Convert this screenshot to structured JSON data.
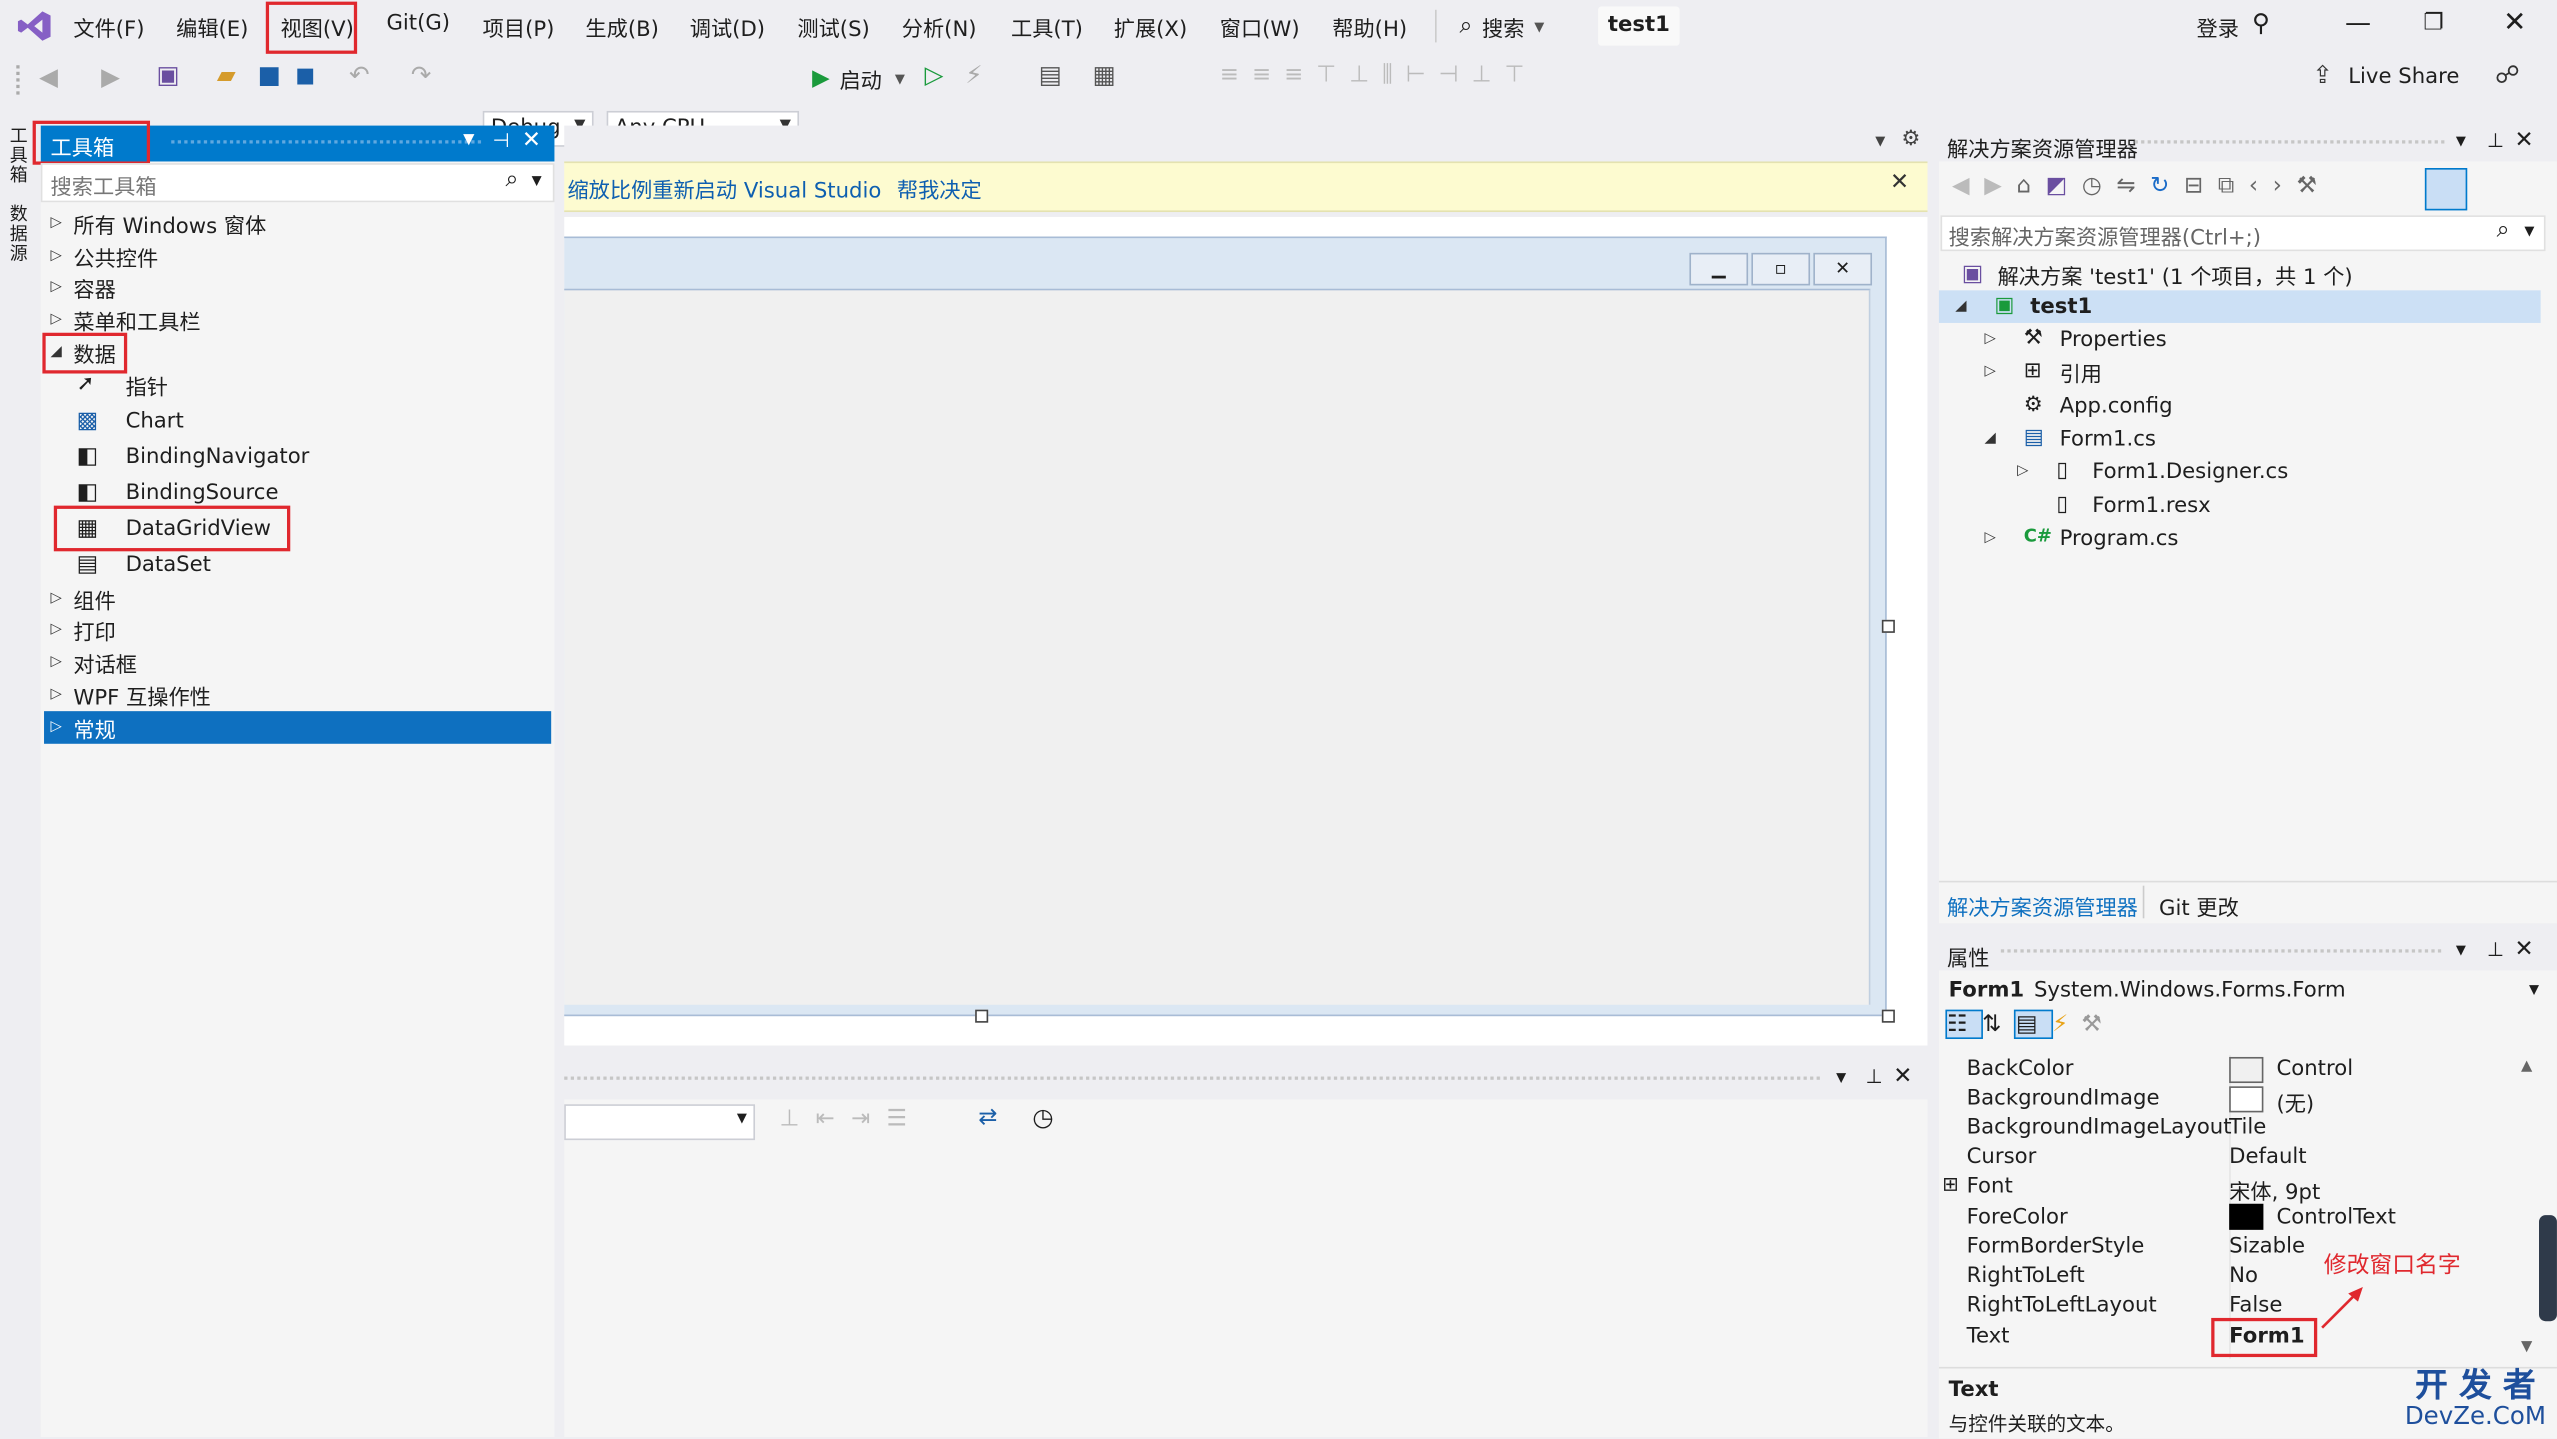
{
  "menubar": {
    "items": [
      "文件(F)",
      "编辑(E)",
      "视图(V)",
      "Git(G)",
      "项目(P)",
      "生成(B)",
      "调试(D)",
      "测试(S)",
      "分析(N)",
      "工具(T)",
      "扩展(X)",
      "窗口(W)",
      "帮助(H)"
    ],
    "search_label": "搜索",
    "project_tab": "test1",
    "login": "登录",
    "live_share": "Live Share"
  },
  "toolbar": {
    "config": "Debug",
    "platform": "Any CPU",
    "start": "启动"
  },
  "side_tabs": [
    "工具箱",
    "数据源"
  ],
  "toolbox": {
    "title": "工具箱",
    "search_placeholder": "搜索工具箱",
    "groups": [
      "所有 Windows 窗体",
      "公共控件",
      "容器",
      "菜单和工具栏",
      "数据"
    ],
    "data_items": [
      "指针",
      "Chart",
      "BindingNavigator",
      "BindingSource",
      "DataGridView",
      "DataSet"
    ],
    "groups_after": [
      "组件",
      "打印",
      "对话框",
      "WPF 互操作性",
      "常规"
    ]
  },
  "infobar": {
    "message": "缩放比例重新启动 Visual Studio",
    "link": "帮我决定"
  },
  "solution_explorer": {
    "title": "解决方案资源管理器",
    "search_placeholder": "搜索解决方案资源管理器(Ctrl+;)",
    "solution": "解决方案 'test1' (1 个项目，共 1 个)",
    "project": "test1",
    "nodes": [
      "Properties",
      "引用",
      "App.config",
      "Form1.cs",
      "Form1.Designer.cs",
      "Form1.resx",
      "Program.cs"
    ],
    "tabs": [
      "解决方案资源管理器",
      "Git 更改"
    ]
  },
  "properties": {
    "title": "属性",
    "object_name": "Form1",
    "object_type": "System.Windows.Forms.Form",
    "rows": [
      {
        "name": "BackColor",
        "value": "Control"
      },
      {
        "name": "BackgroundImage",
        "value": "(无)"
      },
      {
        "name": "BackgroundImageLayout",
        "value": "Tile"
      },
      {
        "name": "Cursor",
        "value": "Default"
      },
      {
        "name": "Font",
        "value": "宋体, 9pt"
      },
      {
        "name": "ForeColor",
        "value": "ControlText"
      },
      {
        "name": "FormBorderStyle",
        "value": "Sizable"
      },
      {
        "name": "RightToLeft",
        "value": "No"
      },
      {
        "name": "RightToLeftLayout",
        "value": "False"
      },
      {
        "name": "Text",
        "value": "Form1"
      }
    ],
    "desc_title": "Text",
    "desc_text": "与控件关联的文本。",
    "annotation": "修改窗口名字"
  },
  "watermark": {
    "line1": "开 发 者",
    "line2": "DevZe.CoM"
  },
  "colors": {
    "accent": "#007acc",
    "selection": "#0e70c0",
    "highlight_box": "#e0282e",
    "infobar": "#fdfbd0"
  }
}
